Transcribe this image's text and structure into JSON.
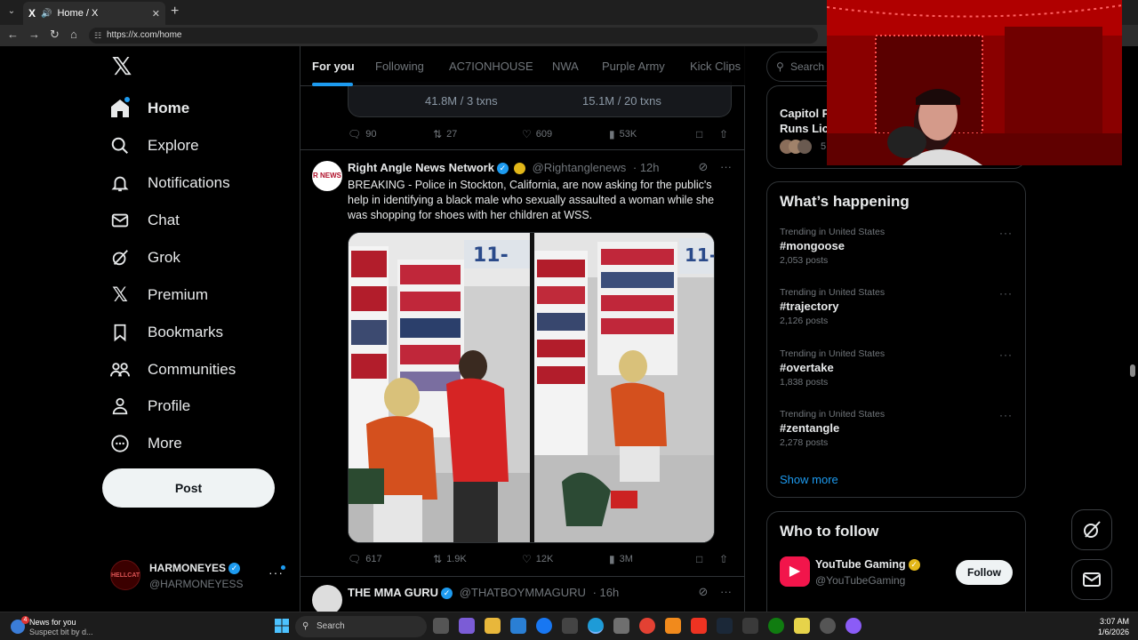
{
  "browser": {
    "tab_title": "Home / X",
    "tab_favicon": "X",
    "url": "https://x.com/home"
  },
  "nav": {
    "items": [
      {
        "label": "Home",
        "icon": "home-icon"
      },
      {
        "label": "Explore",
        "icon": "search-icon"
      },
      {
        "label": "Notifications",
        "icon": "bell-icon"
      },
      {
        "label": "Chat",
        "icon": "mail-icon"
      },
      {
        "label": "Grok",
        "icon": "grok-icon"
      },
      {
        "label": "Premium",
        "icon": "x-icon"
      },
      {
        "label": "Bookmarks",
        "icon": "bookmark-icon"
      },
      {
        "label": "Communities",
        "icon": "communities-icon"
      },
      {
        "label": "Profile",
        "icon": "profile-icon"
      },
      {
        "label": "More",
        "icon": "more-circle-icon"
      }
    ],
    "post_label": "Post",
    "account": {
      "name": "HARMONEYES",
      "handle": "@HARMONEYESS",
      "avatar_text": "HELLCAT"
    }
  },
  "feed": {
    "tabs": [
      "For you",
      "Following",
      "AC7IONHOUSE",
      "NWA",
      "Purple Army",
      "Kick Clips"
    ],
    "prev_card": {
      "left": "41.8M / 3 txns",
      "right": "15.1M / 20 txns"
    },
    "prev_actions": {
      "replies": "90",
      "reposts": "27",
      "likes": "609",
      "views": "53K"
    },
    "tweet1": {
      "author": "Right Angle News Network",
      "handle": "@Rightanglenews",
      "time": "· 12h",
      "avatar_text": "R NEWS",
      "text": "BREAKING - Police in Stockton, California, are now asking for the public's help in identifying a black male who sexually assaulted a woman while she was shopping for shoes with her children at WSS.",
      "media_label_left": "11-",
      "media_label_right": "11-",
      "actions": {
        "replies": "617",
        "reposts": "1.9K",
        "likes": "12K",
        "views": "3M"
      }
    },
    "tweet2": {
      "author": "THE MMA GURU",
      "handle": "@THATBOYMMAGURU",
      "time": "· 16h"
    }
  },
  "sidebar": {
    "search_placeholder": "Search",
    "live_title_1": "Capitol P",
    "live_title_2": "Runs Lice",
    "live_count": "5",
    "whats_happening_title": "What’s happening",
    "trends": [
      {
        "context": "Trending in United States",
        "name": "#mongoose",
        "count": "2,053 posts"
      },
      {
        "context": "Trending in United States",
        "name": "#trajectory",
        "count": "2,126 posts"
      },
      {
        "context": "Trending in United States",
        "name": "#overtake",
        "count": "1,838 posts"
      },
      {
        "context": "Trending in United States",
        "name": "#zentangle",
        "count": "2,278 posts"
      }
    ],
    "show_more": "Show more",
    "who_to_follow_title": "Who to follow",
    "follow_suggestion": {
      "name": "YouTube Gaming",
      "handle": "@YouTubeGaming",
      "button": "Follow"
    }
  },
  "taskbar": {
    "news_title": "News for you",
    "news_subtitle": "Suspect bit by d...",
    "news_badge": "4",
    "search_label": "Search",
    "time": "3:07 AM",
    "date": "1/6/2026"
  },
  "colors": {
    "accent": "#1d9bf0",
    "background": "#000000",
    "text": "#e7e9ea",
    "muted": "#71767b",
    "border": "#2f3336"
  }
}
